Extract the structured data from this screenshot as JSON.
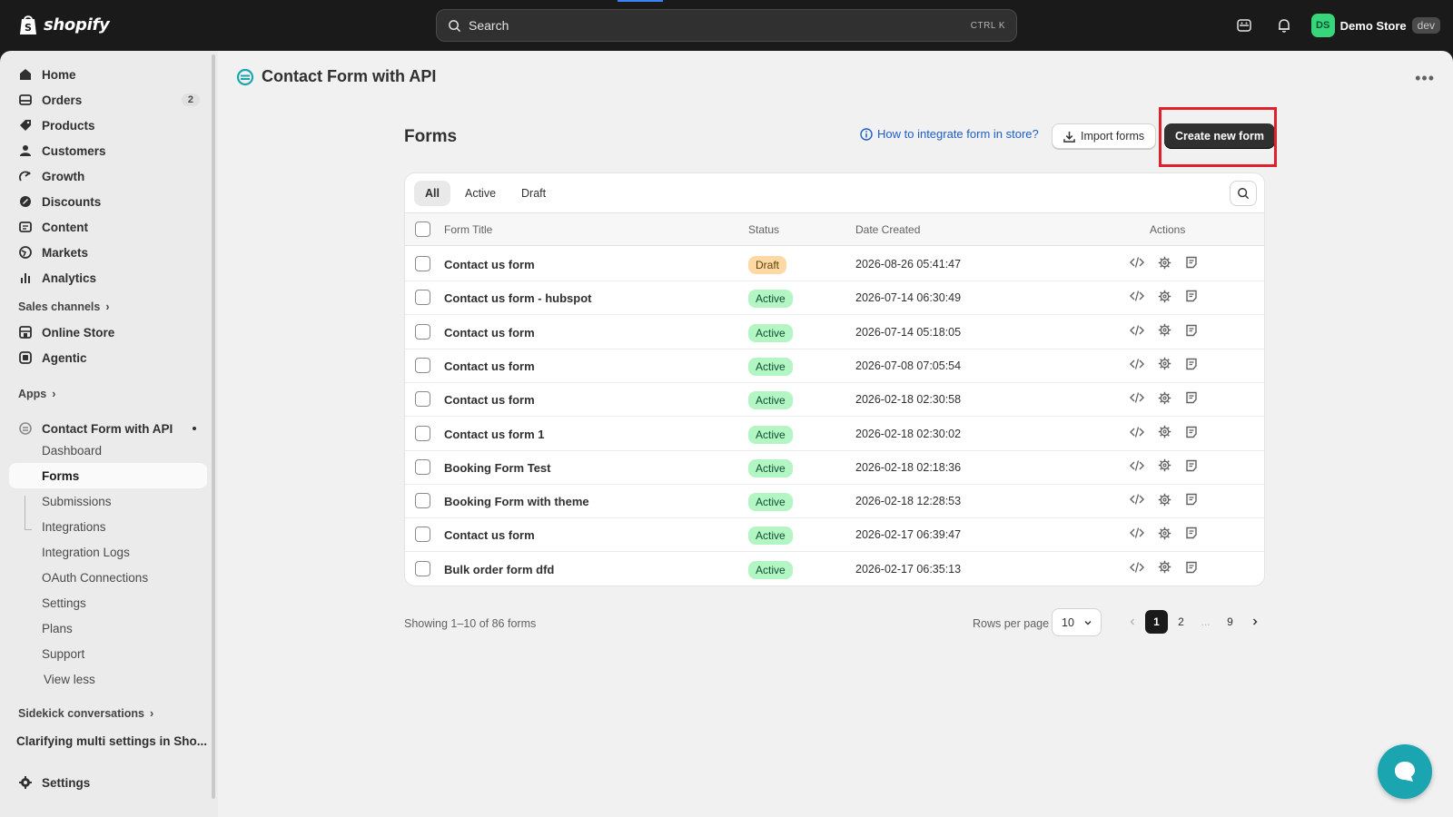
{
  "topbar": {
    "brand": "shopify",
    "search_placeholder": "Search",
    "search_shortcut": "CTRL   K",
    "store_initials": "DS",
    "store_name": "Demo Store",
    "store_env": "dev"
  },
  "sidebar": {
    "main_items": [
      {
        "label": "Home",
        "icon": "home-icon"
      },
      {
        "label": "Orders",
        "icon": "orders-icon",
        "count": "2"
      },
      {
        "label": "Products",
        "icon": "tag-icon"
      },
      {
        "label": "Customers",
        "icon": "person-icon"
      },
      {
        "label": "Growth",
        "icon": "growth-icon"
      },
      {
        "label": "Discounts",
        "icon": "discount-icon"
      },
      {
        "label": "Content",
        "icon": "content-icon"
      },
      {
        "label": "Markets",
        "icon": "globe-icon"
      },
      {
        "label": "Analytics",
        "icon": "analytics-icon"
      }
    ],
    "sales_channels_label": "Sales channels",
    "channels": [
      {
        "label": "Online Store",
        "icon": "store-icon"
      },
      {
        "label": "Agentic",
        "icon": "agentic-icon"
      }
    ],
    "apps_label": "Apps",
    "app_name": "Contact Form with API",
    "app_items": [
      "Dashboard",
      "Forms",
      "Submissions",
      "Integrations",
      "Integration Logs",
      "OAuth Connections",
      "Settings",
      "Plans",
      "Support",
      "View less"
    ],
    "active_app_item": "Forms",
    "sidekick_label": "Sidekick conversations",
    "sidekick_item": "Clarifying multi settings in Sho...",
    "settings_label": "Settings"
  },
  "main": {
    "app_title": "Contact Form with API",
    "page_title": "Forms",
    "help_link": "How to integrate form in store?",
    "import_label": "Import forms",
    "create_label": "Create new form",
    "tabs": [
      "All",
      "Active",
      "Draft"
    ],
    "active_tab": "All",
    "columns": {
      "title": "Form Title",
      "status": "Status",
      "date": "Date Created",
      "actions": "Actions"
    },
    "rows": [
      {
        "title": "Contact us form",
        "status": "Draft",
        "date": "2026-08-26 05:41:47"
      },
      {
        "title": "Contact us form - hubspot",
        "status": "Active",
        "date": "2026-07-14 06:30:49"
      },
      {
        "title": "Contact us form",
        "status": "Active",
        "date": "2026-07-14 05:18:05"
      },
      {
        "title": "Contact us form",
        "status": "Active",
        "date": "2026-07-08 07:05:54"
      },
      {
        "title": "Contact us form",
        "status": "Active",
        "date": "2026-02-18 02:30:58"
      },
      {
        "title": "Contact us form 1",
        "status": "Active",
        "date": "2026-02-18 02:30:02"
      },
      {
        "title": "Booking Form Test",
        "status": "Active",
        "date": "2026-02-18 02:18:36"
      },
      {
        "title": "Booking Form with theme",
        "status": "Active",
        "date": "2026-02-18 12:28:53"
      },
      {
        "title": "Contact us form",
        "status": "Active",
        "date": "2026-02-17 06:39:47"
      },
      {
        "title": "Bulk order form dfd",
        "status": "Active",
        "date": "2026-02-17 06:35:13"
      }
    ],
    "showing_text": "Showing 1–10 of 86 forms",
    "rows_per_page_label": "Rows per page",
    "rows_per_page_value": "10",
    "pages": [
      "1",
      "2",
      "...",
      "9"
    ],
    "current_page": "1"
  },
  "colors": {
    "highlight": "#e0202a",
    "active_badge": "#b4f5c4",
    "draft_badge": "#fed8a5",
    "chat_button": "#1aa5b0"
  }
}
